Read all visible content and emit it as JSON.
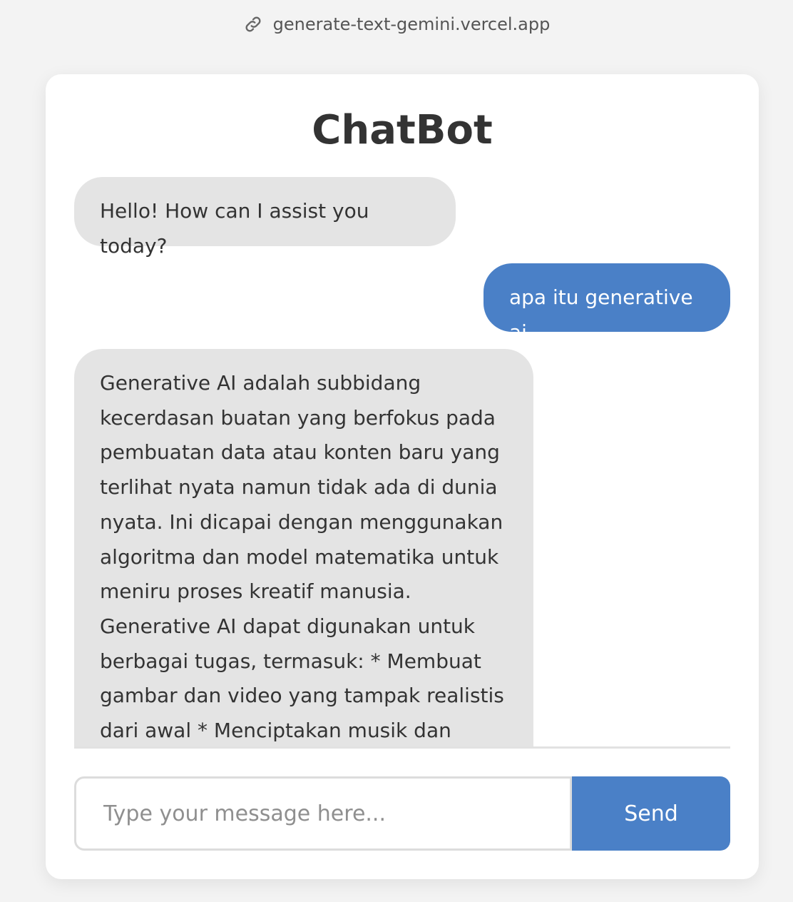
{
  "browser": {
    "url": "generate-text-gemini.vercel.app",
    "link_icon": "link-icon"
  },
  "app": {
    "title": "ChatBot"
  },
  "messages": [
    {
      "role": "bot",
      "text": "Hello! How can I assist you today?"
    },
    {
      "role": "user",
      "text": "apa itu generative ai"
    },
    {
      "role": "bot",
      "text": "Generative AI adalah subbidang kecerdasan buatan yang berfokus pada pembuatan data atau konten baru yang terlihat nyata namun tidak ada di dunia nyata. Ini dicapai dengan menggunakan algoritma dan model matematika untuk meniru proses kreatif manusia. Generative AI dapat digunakan untuk berbagai tugas, termasuk: * Membuat gambar dan video yang tampak realistis dari awal * Menciptakan musik dan suara yang"
    }
  ],
  "input": {
    "placeholder": "Type your message here...",
    "value": ""
  },
  "send_button": {
    "label": "Send"
  },
  "colors": {
    "accent": "#4a80c7",
    "bot_bubble": "#e4e4e4",
    "background": "#f3f3f3"
  }
}
